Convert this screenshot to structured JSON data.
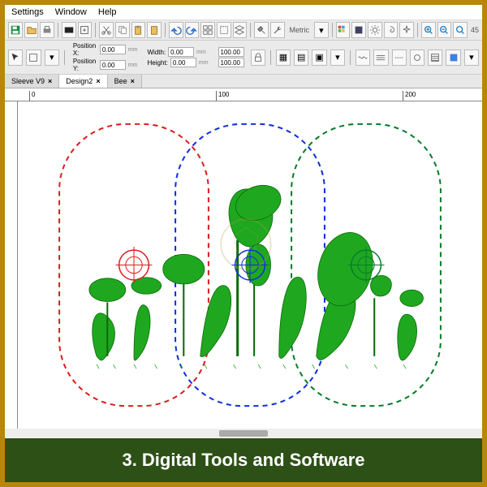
{
  "menu": {
    "settings": "Settings",
    "window": "Window",
    "help": "Help"
  },
  "position": {
    "xlabel": "Position X:",
    "ylabel": "Position Y:",
    "x": "0.00",
    "y": "0.00",
    "wlabel": "Width:",
    "hlabel": "Height:",
    "w": "0.00",
    "h": "0.00",
    "pct1": "100.00",
    "pct2": "100.00",
    "unit": "mm"
  },
  "metric": "Metric",
  "zoom": "45",
  "tabs": [
    {
      "label": "Sleeve V9",
      "active": false
    },
    {
      "label": "Design2",
      "active": true
    },
    {
      "label": "Bee",
      "active": false
    }
  ],
  "ruler": {
    "t0": "0",
    "t100": "100",
    "t200": "200"
  },
  "hoops": {
    "left": {
      "color": "#d92020"
    },
    "mid": {
      "color": "#1030e0"
    },
    "right": {
      "color": "#0a7d2c"
    }
  },
  "design_color": "#1fa81f",
  "caption": "3. Digital Tools and Software"
}
